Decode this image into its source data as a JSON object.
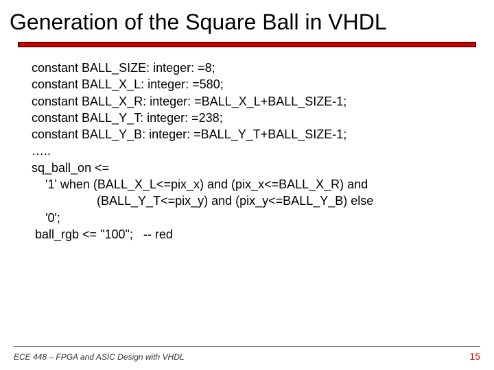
{
  "title": "Generation of the Square Ball in VHDL",
  "code": {
    "l1": "constant BALL_SIZE: integer: =8;",
    "l2": "constant BALL_X_L: integer: =580;",
    "l3": "constant BALL_X_R: integer: =BALL_X_L+BALL_SIZE-1;",
    "l4": "constant BALL_Y_T: integer: =238;",
    "l5": "constant BALL_Y_B: integer: =BALL_Y_T+BALL_SIZE-1;",
    "l6": "…..",
    "l7": "sq_ball_on <=",
    "l8": "    '1' when (BALL_X_L<=pix_x) and (pix_x<=BALL_X_R) and",
    "l9": "                   (BALL_Y_T<=pix_y) and (pix_y<=BALL_Y_B) else",
    "l10": "    '0';",
    "l11": " ball_rgb <= \"100\";   -- red"
  },
  "footer": {
    "left": "ECE 448 – FPGA and ASIC Design with VHDL",
    "right": "15"
  }
}
